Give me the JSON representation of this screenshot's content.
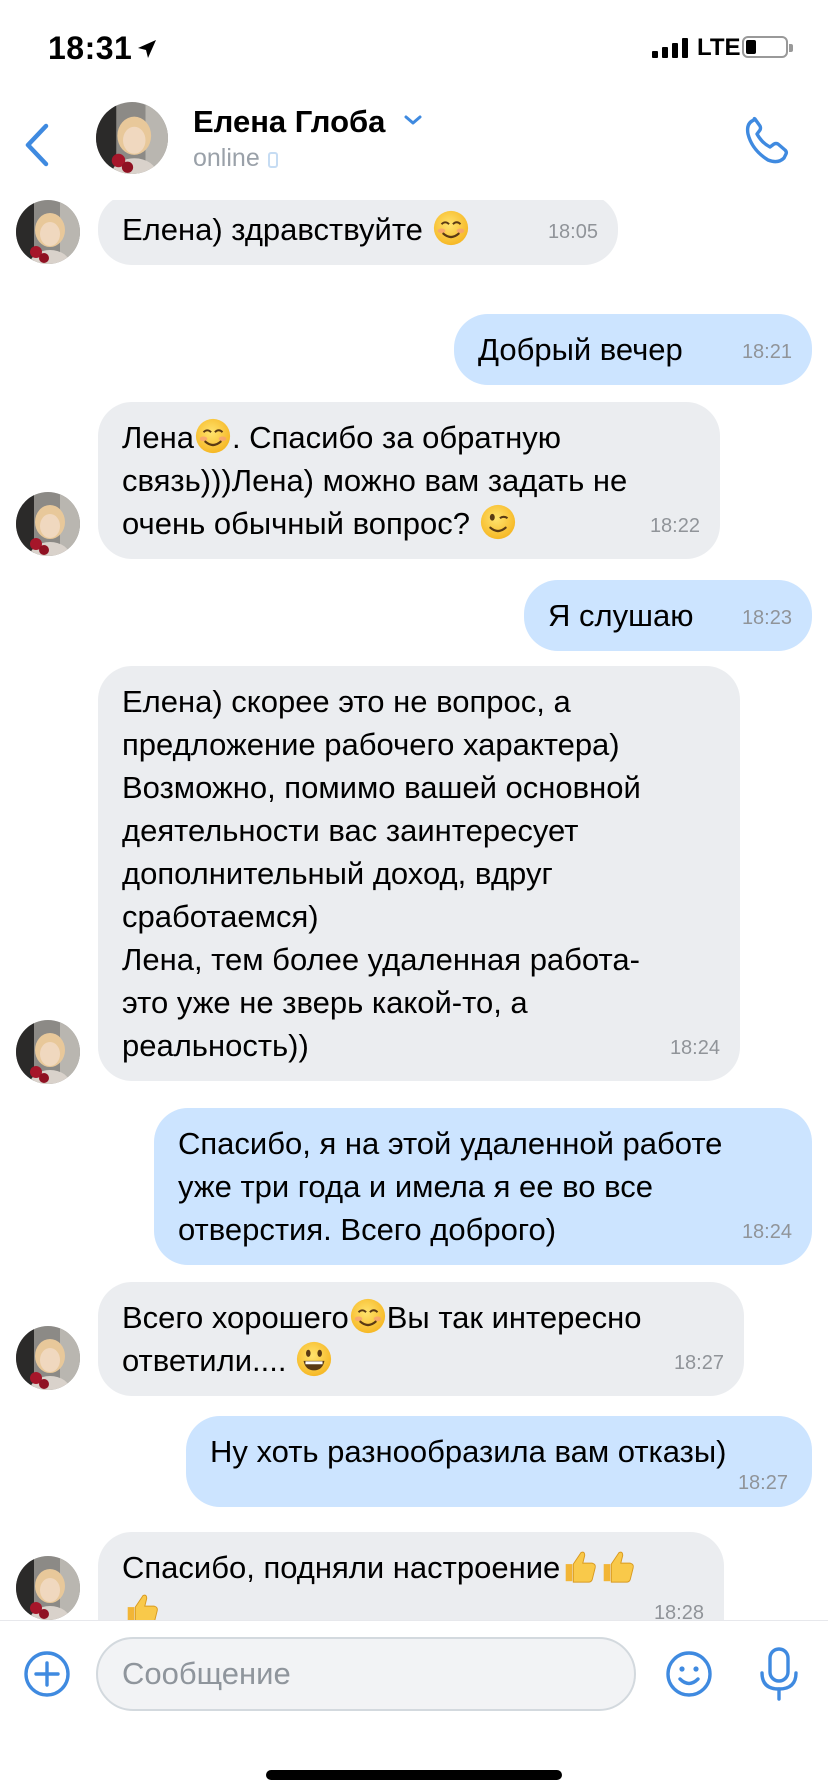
{
  "status_bar": {
    "time": "18:31",
    "network": "LTE"
  },
  "header": {
    "contact_name": "Елена Глоба",
    "presence": "online"
  },
  "messages": [
    {
      "dir": "in",
      "text": "Елена) здравствуйте",
      "time": "18:05"
    },
    {
      "dir": "out",
      "text": "Добрый вечер",
      "time": "18:21"
    },
    {
      "dir": "in",
      "text_1": "Лена",
      "text_2": ". Спасибо за обратную",
      "text_3": "связь)))Лена) можно вам задать не",
      "text_4": "очень обычный вопрос?",
      "time": "18:22"
    },
    {
      "dir": "out",
      "text": "Я слушаю",
      "time": "18:23"
    },
    {
      "dir": "in",
      "lines": [
        "Елена) скорее это не вопрос, а",
        "предложение рабочего характера)",
        "Возможно, помимо вашей основной",
        "деятельности вас заинтересует",
        "дополнительный доход, вдруг",
        "сработаемся)",
        "Лена, тем более удаленная работа-",
        "это уже не зверь какой-то, а",
        "реальность))"
      ],
      "time": "18:24"
    },
    {
      "dir": "out",
      "lines": [
        "Спасибо, я на этой удаленной работе",
        "уже три года и имела я ее во все",
        "отверстия. Всего доброго)"
      ],
      "time": "18:24"
    },
    {
      "dir": "in",
      "text_1": "Всего хорошего",
      "text_2": "Вы так интересно",
      "text_3": "ответили....",
      "time": "18:27"
    },
    {
      "dir": "out",
      "text": "Ну хоть разнообразила вам отказы)",
      "time": "18:27"
    },
    {
      "dir": "in",
      "text": "Спасибо, подняли настроение",
      "time": "18:28"
    }
  ],
  "input": {
    "placeholder": "Сообщение"
  },
  "colors": {
    "accent": "#3f8ae0",
    "incoming_bubble": "#ebedf0",
    "outgoing_bubble": "#cce4ff",
    "meta_text": "#909499"
  },
  "icons": [
    "back-chevron-icon",
    "chevron-down-icon",
    "phone-icon",
    "plus-circle-icon",
    "smiley-icon",
    "microphone-icon",
    "location-arrow-icon",
    "signal-icon",
    "battery-icon"
  ]
}
